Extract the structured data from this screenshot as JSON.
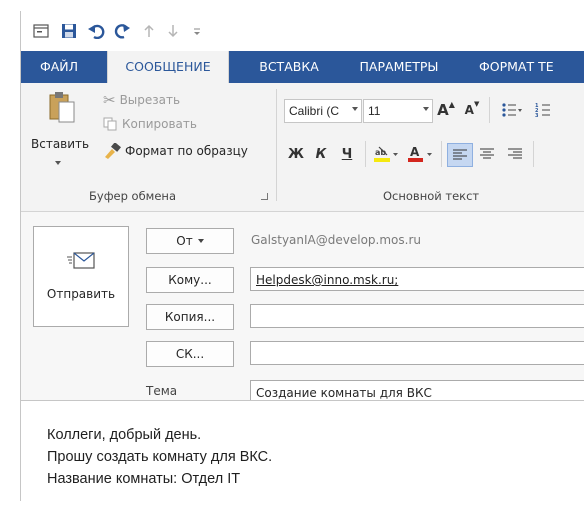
{
  "quick_access": {
    "icons": [
      "window-menu-icon",
      "save-icon",
      "undo-icon",
      "redo-icon",
      "up-arrow-icon",
      "down-arrow-icon",
      "customize-qat-icon"
    ]
  },
  "tabs": [
    {
      "label": "ФАЙЛ",
      "active": false
    },
    {
      "label": "СООБЩЕНИЕ",
      "active": true
    },
    {
      "label": "ВСТАВКА",
      "active": false
    },
    {
      "label": "ПАРАМЕТРЫ",
      "active": false
    },
    {
      "label": "ФОРМАТ ТЕ",
      "active": false
    }
  ],
  "ribbon": {
    "clipboard": {
      "paste_label": "Вставить",
      "cut_label": "Вырезать",
      "copy_label": "Копировать",
      "format_painter_label": "Формат по образцу",
      "group_label": "Буфер обмена"
    },
    "basic_text": {
      "font_name": "Calibri (С",
      "font_size": "11",
      "bold": "Ж",
      "italic": "К",
      "underline": "Ч",
      "font_color_letter": "А",
      "group_label": "Основной текст"
    },
    "colors": {
      "accent": "#2b579a",
      "highlight": "#f5e90f",
      "font_color": "#d3261e"
    }
  },
  "message": {
    "send_label": "Отправить",
    "from_button": "От",
    "from_value": "GalstyanIA@develop.mos.ru",
    "to_button": "Кому...",
    "to_value": "Helpdesk@inno.msk.ru;",
    "cc_button": "Копия...",
    "cc_value": "",
    "bcc_button": "СК...",
    "bcc_value": "",
    "subject_label": "Тема",
    "subject_value": "Создание комнаты для ВКС",
    "body_lines": [
      "Коллеги, добрый день.",
      "Прошу создать комнату для ВКС.",
      "Название комнаты: Отдел IT"
    ]
  }
}
